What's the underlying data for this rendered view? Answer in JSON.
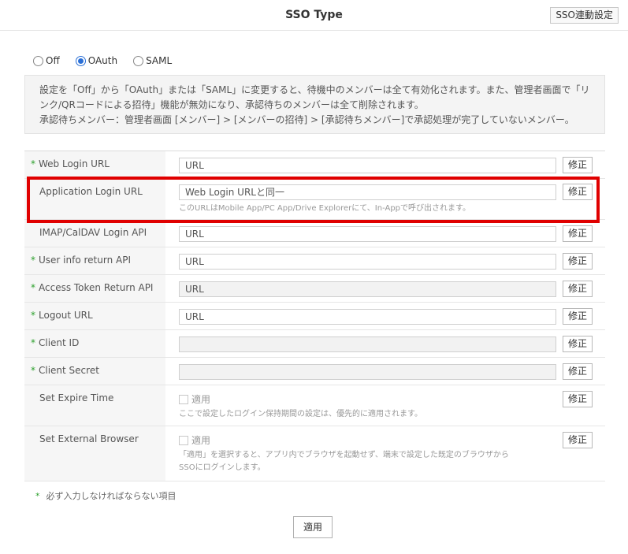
{
  "header": {
    "title": "SSO Type",
    "link_button": "SSO連動設定"
  },
  "sso_type": {
    "options": [
      {
        "label": "Off",
        "checked": false
      },
      {
        "label": "OAuth",
        "checked": true
      },
      {
        "label": "SAML",
        "checked": false
      }
    ]
  },
  "notice": {
    "line1": "設定を「Off」から「OAuth」または「SAML」に変更すると、待機中のメンバーは全て有効化されます。また、管理者画面で「リ",
    "line2": "ンク/QRコードによる招待」機能が無効になり、承認待ちのメンバーは全て削除されます。",
    "line3": "承認待ちメンバー：管理者画面 [メンバー] > [メンバーの招待] > [承認待ちメンバー]で承認処理が完了していないメンバー。"
  },
  "fields": [
    {
      "label": "Web Login URL",
      "required": true,
      "value": "URL",
      "disabled": false,
      "help": "",
      "edit": "修正"
    },
    {
      "label": "Application Login URL",
      "required": false,
      "value": "Web Login URLと同一",
      "disabled": false,
      "help": "このURLはMobile App/PC App/Drive Explorerにて、In-Appで呼び出されます。",
      "edit": "修正"
    },
    {
      "label": "IMAP/CalDAV Login API",
      "required": false,
      "value": "URL",
      "disabled": false,
      "help": "",
      "edit": "修正"
    },
    {
      "label": "User info return API",
      "required": true,
      "value": "URL",
      "disabled": false,
      "help": "",
      "edit": "修正"
    },
    {
      "label": "Access Token Return API",
      "required": true,
      "value": "URL",
      "disabled": true,
      "help": "",
      "edit": "修正"
    },
    {
      "label": "Logout URL",
      "required": true,
      "value": "URL",
      "disabled": false,
      "help": "",
      "edit": "修正"
    },
    {
      "label": "Client ID",
      "required": true,
      "value": "",
      "disabled": true,
      "help": "",
      "edit": "修正"
    },
    {
      "label": "Client Secret",
      "required": true,
      "value": "",
      "disabled": true,
      "help": "",
      "edit": "修正"
    }
  ],
  "expire": {
    "label": "Set Expire Time",
    "checkbox_label": "適用",
    "help": "ここで設定したログイン保持期間の設定は、優先的に適用されます。",
    "edit": "修正"
  },
  "browser": {
    "label": "Set External Browser",
    "checkbox_label": "適用",
    "help1": "「適用」を選択すると、アプリ内でブラウザを起動せず、端末で設定した既定のブラウザから",
    "help2": "SSOにログインします。",
    "edit": "修正"
  },
  "legend": {
    "mark": "*",
    "text": "必ず入力しなければならない項目"
  },
  "apply_button": "適用",
  "colors": {
    "required_mark": "#2ca02c",
    "highlight": "#e00000",
    "radio_checked": "#2a6fd6"
  }
}
